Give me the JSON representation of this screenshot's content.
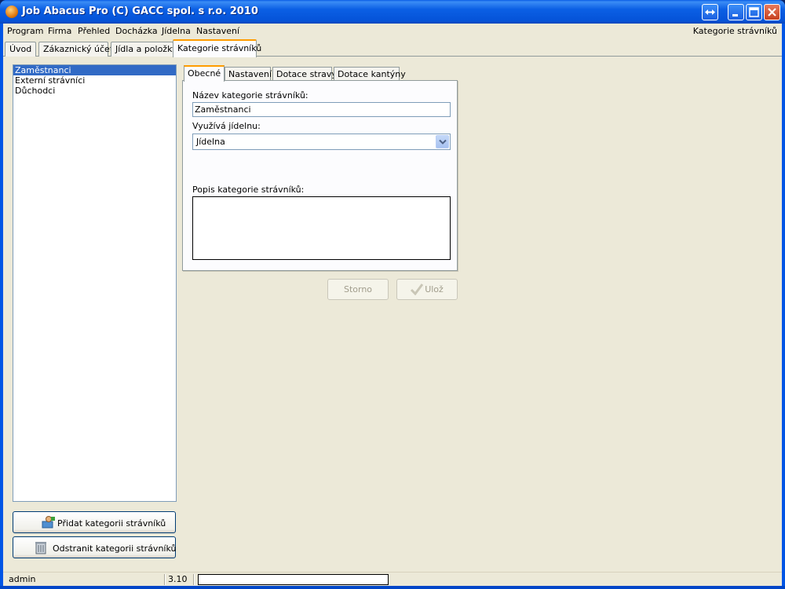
{
  "window": {
    "title": "Job Abacus Pro (C) GACC spol. s r.o. 2010",
    "icon": "app-orange-ball-icon",
    "controls": [
      "resize-icon",
      "minimize-icon",
      "maximize-icon",
      "close-icon"
    ]
  },
  "menu": {
    "items": [
      {
        "label": "Program"
      },
      {
        "label": "Firma"
      },
      {
        "label": "Přehled"
      },
      {
        "label": "Docházka"
      },
      {
        "label": "Jídelna"
      },
      {
        "label": "Nastavení"
      }
    ],
    "right_label": "Kategorie strávníků"
  },
  "main_tabs": [
    {
      "label": "Úvod"
    },
    {
      "label": "Zákaznický účet"
    },
    {
      "label": "Jídla a položky"
    },
    {
      "label": "Kategorie strávníků",
      "active": true
    }
  ],
  "category_list": {
    "items": [
      {
        "label": "Zaměstnanci",
        "selected": true
      },
      {
        "label": "Externí strávníci"
      },
      {
        "label": "Důchodci"
      }
    ]
  },
  "buttons": {
    "add_category": "Přidat kategorii strávníků",
    "remove_category": "Odstranit kategorii strávníků",
    "cancel": "Storno",
    "save": "Ulož"
  },
  "detail_tabs": [
    {
      "label": "Obecné",
      "active": true
    },
    {
      "label": "Nastavení"
    },
    {
      "label": "Dotace stravy"
    },
    {
      "label": "Dotace kantýny"
    }
  ],
  "form": {
    "name_label": "Název kategorie strávníků:",
    "name_value": "Zaměstnanci",
    "canteen_label": "Využívá jídelnu:",
    "canteen_value": "Jídelna",
    "description_label": "Popis kategorie strávníků:",
    "description_value": ""
  },
  "status": {
    "user": "admin",
    "version": "3.10"
  },
  "colors": {
    "titlebar": "#0058e6",
    "selection": "#316ac5",
    "tab_accent": "#ff9c00",
    "face": "#ece9d8"
  }
}
